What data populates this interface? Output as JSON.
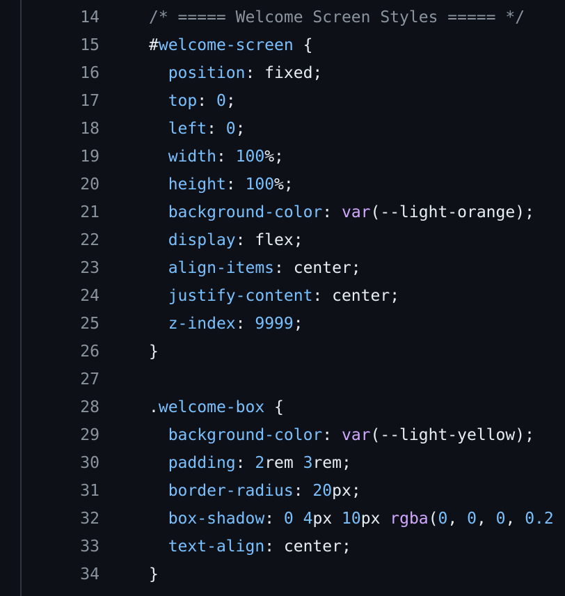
{
  "editor": {
    "lines": [
      {
        "number": "14",
        "tokens": [
          {
            "t": "comment",
            "v": "/* ===== Welcome Screen Styles ===== */"
          }
        ]
      },
      {
        "number": "15",
        "tokens": [
          {
            "t": "plain",
            "v": "#"
          },
          {
            "t": "sel",
            "v": "welcome-screen"
          },
          {
            "t": "plain",
            "v": " {"
          }
        ]
      },
      {
        "number": "16",
        "tokens": [
          {
            "t": "plain",
            "v": "  "
          },
          {
            "t": "prop",
            "v": "position"
          },
          {
            "t": "plain",
            "v": ": fixed;"
          }
        ]
      },
      {
        "number": "17",
        "tokens": [
          {
            "t": "plain",
            "v": "  "
          },
          {
            "t": "prop",
            "v": "top"
          },
          {
            "t": "plain",
            "v": ": "
          },
          {
            "t": "num",
            "v": "0"
          },
          {
            "t": "plain",
            "v": ";"
          }
        ]
      },
      {
        "number": "18",
        "tokens": [
          {
            "t": "plain",
            "v": "  "
          },
          {
            "t": "prop",
            "v": "left"
          },
          {
            "t": "plain",
            "v": ": "
          },
          {
            "t": "num",
            "v": "0"
          },
          {
            "t": "plain",
            "v": ";"
          }
        ]
      },
      {
        "number": "19",
        "tokens": [
          {
            "t": "plain",
            "v": "  "
          },
          {
            "t": "prop",
            "v": "width"
          },
          {
            "t": "plain",
            "v": ": "
          },
          {
            "t": "num",
            "v": "100"
          },
          {
            "t": "plain",
            "v": "%;"
          }
        ]
      },
      {
        "number": "20",
        "tokens": [
          {
            "t": "plain",
            "v": "  "
          },
          {
            "t": "prop",
            "v": "height"
          },
          {
            "t": "plain",
            "v": ": "
          },
          {
            "t": "num",
            "v": "100"
          },
          {
            "t": "plain",
            "v": "%;"
          }
        ]
      },
      {
        "number": "21",
        "tokens": [
          {
            "t": "plain",
            "v": "  "
          },
          {
            "t": "prop",
            "v": "background-color"
          },
          {
            "t": "plain",
            "v": ": "
          },
          {
            "t": "fn",
            "v": "var"
          },
          {
            "t": "plain",
            "v": "(--light-orange);"
          }
        ]
      },
      {
        "number": "22",
        "tokens": [
          {
            "t": "plain",
            "v": "  "
          },
          {
            "t": "prop",
            "v": "display"
          },
          {
            "t": "plain",
            "v": ": flex;"
          }
        ]
      },
      {
        "number": "23",
        "tokens": [
          {
            "t": "plain",
            "v": "  "
          },
          {
            "t": "prop",
            "v": "align-items"
          },
          {
            "t": "plain",
            "v": ": center;"
          }
        ]
      },
      {
        "number": "24",
        "tokens": [
          {
            "t": "plain",
            "v": "  "
          },
          {
            "t": "prop",
            "v": "justify-content"
          },
          {
            "t": "plain",
            "v": ": center;"
          }
        ]
      },
      {
        "number": "25",
        "tokens": [
          {
            "t": "plain",
            "v": "  "
          },
          {
            "t": "prop",
            "v": "z-index"
          },
          {
            "t": "plain",
            "v": ": "
          },
          {
            "t": "num",
            "v": "9999"
          },
          {
            "t": "plain",
            "v": ";"
          }
        ]
      },
      {
        "number": "26",
        "tokens": [
          {
            "t": "plain",
            "v": "}"
          }
        ]
      },
      {
        "number": "27",
        "tokens": []
      },
      {
        "number": "28",
        "tokens": [
          {
            "t": "plain",
            "v": "."
          },
          {
            "t": "sel",
            "v": "welcome-box"
          },
          {
            "t": "plain",
            "v": " {"
          }
        ]
      },
      {
        "number": "29",
        "tokens": [
          {
            "t": "plain",
            "v": "  "
          },
          {
            "t": "prop",
            "v": "background-color"
          },
          {
            "t": "plain",
            "v": ": "
          },
          {
            "t": "fn",
            "v": "var"
          },
          {
            "t": "plain",
            "v": "(--light-yellow);"
          }
        ]
      },
      {
        "number": "30",
        "tokens": [
          {
            "t": "plain",
            "v": "  "
          },
          {
            "t": "prop",
            "v": "padding"
          },
          {
            "t": "plain",
            "v": ": "
          },
          {
            "t": "num",
            "v": "2"
          },
          {
            "t": "plain",
            "v": "rem "
          },
          {
            "t": "num",
            "v": "3"
          },
          {
            "t": "plain",
            "v": "rem;"
          }
        ]
      },
      {
        "number": "31",
        "tokens": [
          {
            "t": "plain",
            "v": "  "
          },
          {
            "t": "prop",
            "v": "border-radius"
          },
          {
            "t": "plain",
            "v": ": "
          },
          {
            "t": "num",
            "v": "20"
          },
          {
            "t": "plain",
            "v": "px;"
          }
        ]
      },
      {
        "number": "32",
        "tokens": [
          {
            "t": "plain",
            "v": "  "
          },
          {
            "t": "prop",
            "v": "box-shadow"
          },
          {
            "t": "plain",
            "v": ": "
          },
          {
            "t": "num",
            "v": "0"
          },
          {
            "t": "plain",
            "v": " "
          },
          {
            "t": "num",
            "v": "4"
          },
          {
            "t": "plain",
            "v": "px "
          },
          {
            "t": "num",
            "v": "10"
          },
          {
            "t": "plain",
            "v": "px "
          },
          {
            "t": "fn",
            "v": "rgba"
          },
          {
            "t": "plain",
            "v": "("
          },
          {
            "t": "num",
            "v": "0"
          },
          {
            "t": "plain",
            "v": ", "
          },
          {
            "t": "num",
            "v": "0"
          },
          {
            "t": "plain",
            "v": ", "
          },
          {
            "t": "num",
            "v": "0"
          },
          {
            "t": "plain",
            "v": ", "
          },
          {
            "t": "num",
            "v": "0.2"
          }
        ]
      },
      {
        "number": "33",
        "tokens": [
          {
            "t": "plain",
            "v": "  "
          },
          {
            "t": "prop",
            "v": "text-align"
          },
          {
            "t": "plain",
            "v": ": center;"
          }
        ]
      },
      {
        "number": "34",
        "tokens": [
          {
            "t": "plain",
            "v": "}"
          }
        ]
      }
    ]
  }
}
